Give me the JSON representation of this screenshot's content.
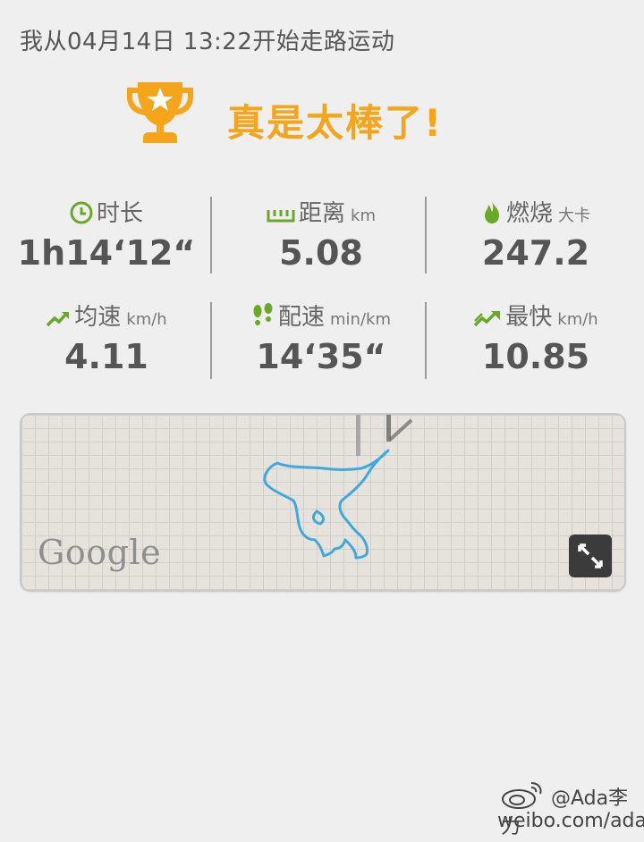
{
  "header": {
    "text": "我从04月14日 13:22开始走路运动"
  },
  "banner": {
    "icon": "trophy-icon",
    "text": "真是太棒了!"
  },
  "stats": {
    "duration": {
      "icon": "clock-icon",
      "label": "时长",
      "unit": "",
      "value": "1h14‘12“"
    },
    "distance": {
      "icon": "ruler-icon",
      "label": "距离",
      "unit": "km",
      "value": "5.08"
    },
    "calories": {
      "icon": "flame-icon",
      "label": "燃烧",
      "unit": "大卡",
      "value": "247.2"
    },
    "avg_speed": {
      "icon": "trend-up-icon",
      "label": "均速",
      "unit": "km/h",
      "value": "4.11"
    },
    "pace": {
      "icon": "footprints-icon",
      "label": "配速",
      "unit": "min/km",
      "value": "14‘35“"
    },
    "max_speed": {
      "icon": "fast-trend-icon",
      "label": "最快",
      "unit": "km/h",
      "value": "10.85"
    }
  },
  "map": {
    "logo_text": "Google",
    "expand_icon": "expand-icon",
    "route_color": "#3fa9dd"
  },
  "watermark": {
    "user": "@Ada李力",
    "url": "weibo.com/adali",
    "icon": "weibo-icon"
  },
  "colors": {
    "accent": "#f5a51a",
    "green": "#6aa829",
    "text": "#555555"
  }
}
